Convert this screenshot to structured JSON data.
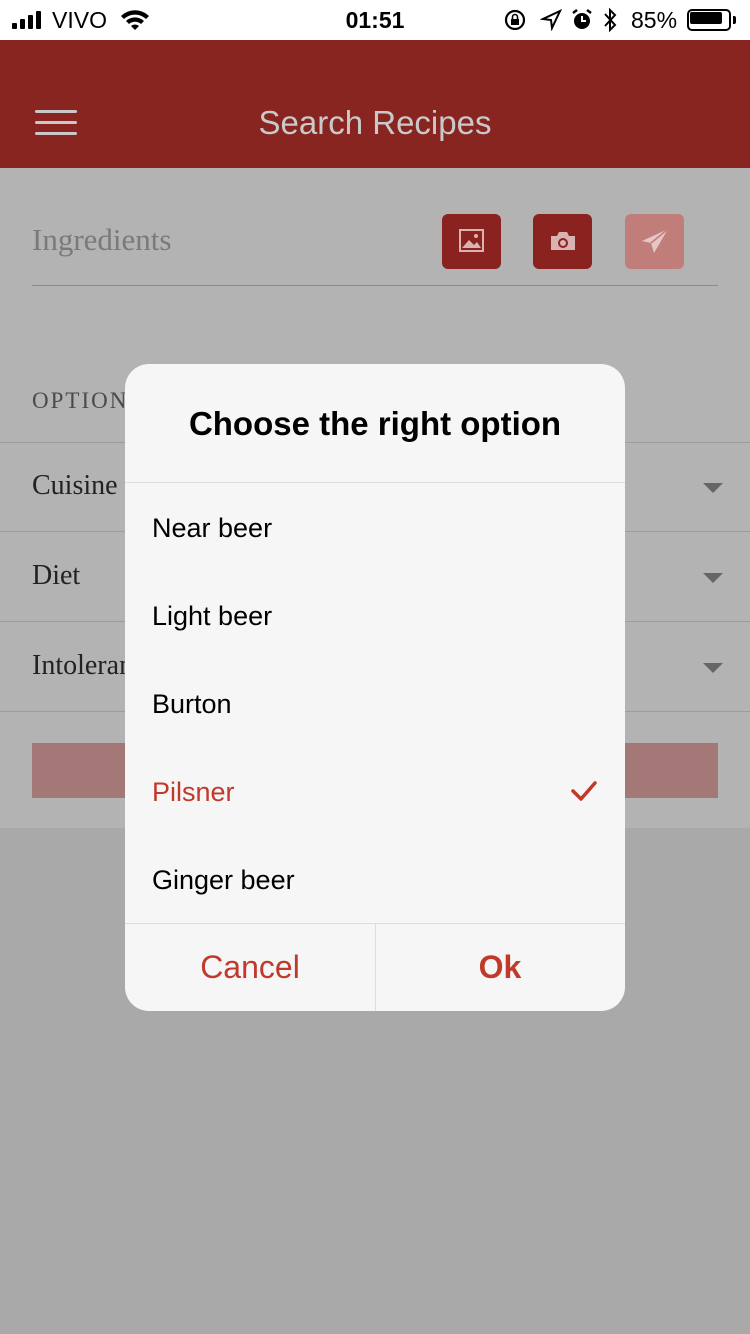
{
  "status_bar": {
    "carrier": "VIVO",
    "time": "01:51",
    "battery_percent": "85%",
    "battery_level": 0.85
  },
  "header": {
    "title": "Search Recipes"
  },
  "search": {
    "ingredients_placeholder": "Ingredients"
  },
  "options": {
    "section_label": "OPTION",
    "rows": [
      {
        "label": "Cuisine"
      },
      {
        "label": "Diet"
      },
      {
        "label": "Intoleran"
      }
    ]
  },
  "dialog": {
    "title": "Choose the right option",
    "items": [
      {
        "label": "Near beer",
        "selected": false
      },
      {
        "label": "Light beer",
        "selected": false
      },
      {
        "label": "Burton",
        "selected": false
      },
      {
        "label": "Pilsner",
        "selected": true
      },
      {
        "label": "Ginger beer",
        "selected": false
      }
    ],
    "cancel_label": "Cancel",
    "ok_label": "Ok"
  },
  "colors": {
    "brand": "#892521",
    "accent": "#c0392b"
  }
}
